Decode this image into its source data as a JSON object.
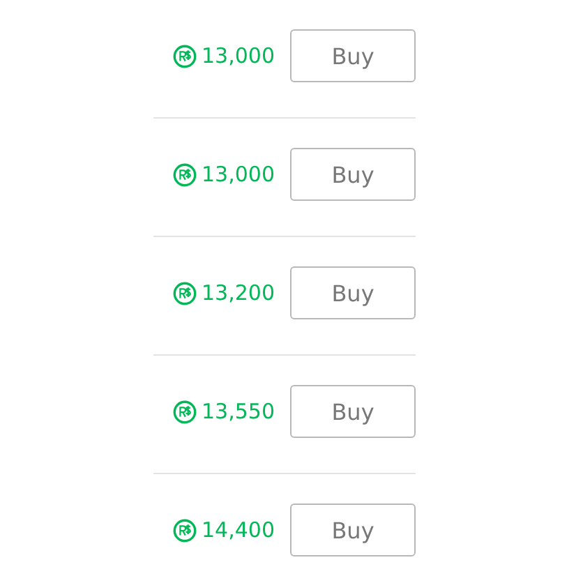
{
  "items": [
    {
      "price": "13,000",
      "button": "Buy"
    },
    {
      "price": "13,000",
      "button": "Buy"
    },
    {
      "price": "13,200",
      "button": "Buy"
    },
    {
      "price": "13,550",
      "button": "Buy"
    },
    {
      "price": "14,400",
      "button": "Buy"
    }
  ]
}
